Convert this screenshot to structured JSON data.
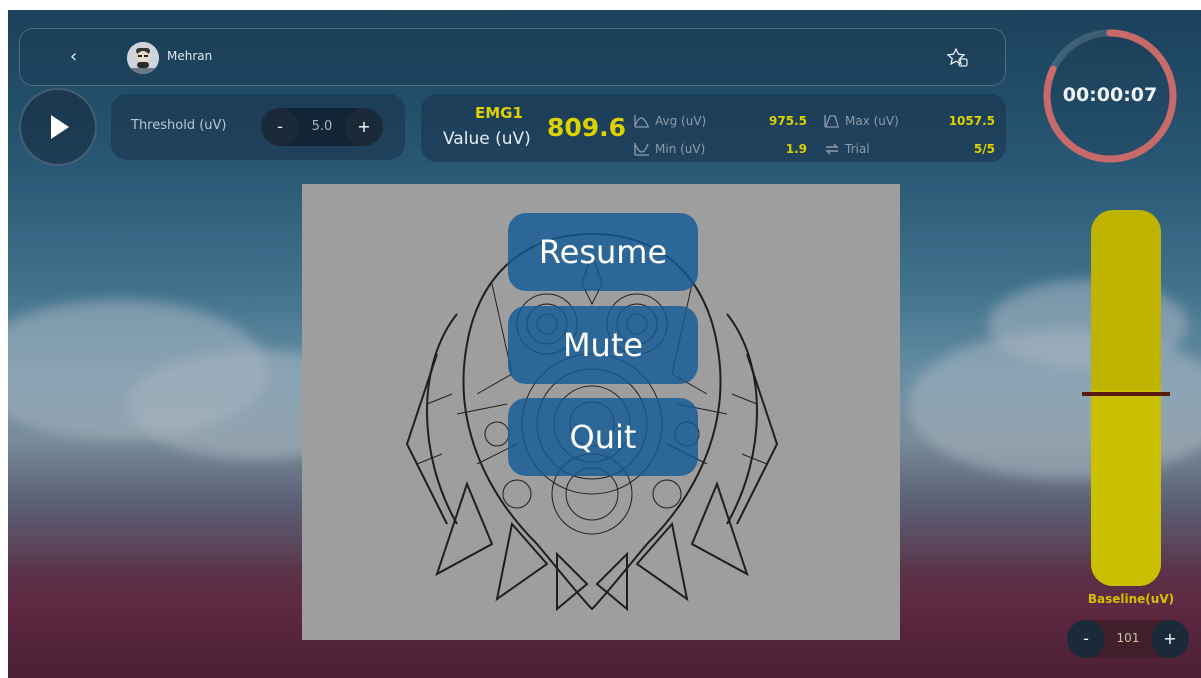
{
  "header": {
    "user_name": "Mehran",
    "back_icon": "chevron-left-icon",
    "favorite_icon": "star-add-icon"
  },
  "controls": {
    "play_icon": "play-icon",
    "threshold_label": "Threshold (uV)",
    "threshold_value": "5.0",
    "minus": "-",
    "plus": "+"
  },
  "stats": {
    "channel": "EMG1",
    "value_label": "Value (uV)",
    "value": "809.6",
    "avg_label": "Avg (uV)",
    "avg": "975.5",
    "min_label": "Min (uV)",
    "min": "1.9",
    "max_label": "Max (uV)",
    "max": "1057.5",
    "trial_label": "Trial",
    "trial": "5/5"
  },
  "timer": {
    "text": "00:00:07",
    "progress_fraction": 0.82,
    "color": "#c96a6a"
  },
  "pause_menu": {
    "resume": "Resume",
    "mute": "Mute",
    "quit": "Quit"
  },
  "baseline": {
    "label": "Baseline(uV)",
    "value": "101",
    "fill_fraction": 0.52,
    "color": "#cbc000"
  }
}
